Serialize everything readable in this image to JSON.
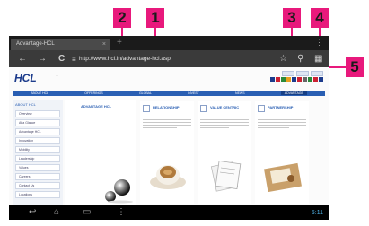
{
  "callouts": {
    "c1": "1",
    "c2": "2",
    "c3": "3",
    "c4": "4",
    "c5": "5"
  },
  "browser": {
    "tab_title": "Advantage-HCL",
    "tab_close": "×",
    "new_tab": "+",
    "menu": "⋮",
    "url": "http://www.hcl.in/advantage-hcl.asp"
  },
  "toolbar_icons": {
    "back": "←",
    "forward": "→",
    "reload": "C",
    "page": "≡",
    "bookmark": "☆",
    "search": "⚲",
    "tabs": "▦"
  },
  "site": {
    "logo": "HCL",
    "logo_tagline": "...",
    "nav": [
      "ABOUT HCL",
      "OFFERINGS",
      "GLOBAL",
      "INVEST",
      "NEWS",
      "ADVANTAGE"
    ],
    "sidebar_heading": "ABOUT HCL",
    "sidebar_items": [
      "Overview",
      "At a Glance",
      "Advantage HCL",
      "Innovation",
      "Mobility",
      "Leadership",
      "Values",
      "Careers",
      "Contact Us",
      "Locations"
    ],
    "advantage_title": "ADVANTAGE HCL",
    "cards": [
      {
        "title": "RELATIONSHIP"
      },
      {
        "title": "VALUE CENTRIC"
      },
      {
        "title": "PARTNERSHIP"
      }
    ]
  },
  "system_bar": {
    "back": "↩",
    "home": "⌂",
    "recent": "▭",
    "menu": "⋮",
    "status": "5:11"
  },
  "colors": {
    "callout": "#e8197c",
    "hcl_blue": "#1d3c8c",
    "nav_blue": "#2a5fb3"
  }
}
